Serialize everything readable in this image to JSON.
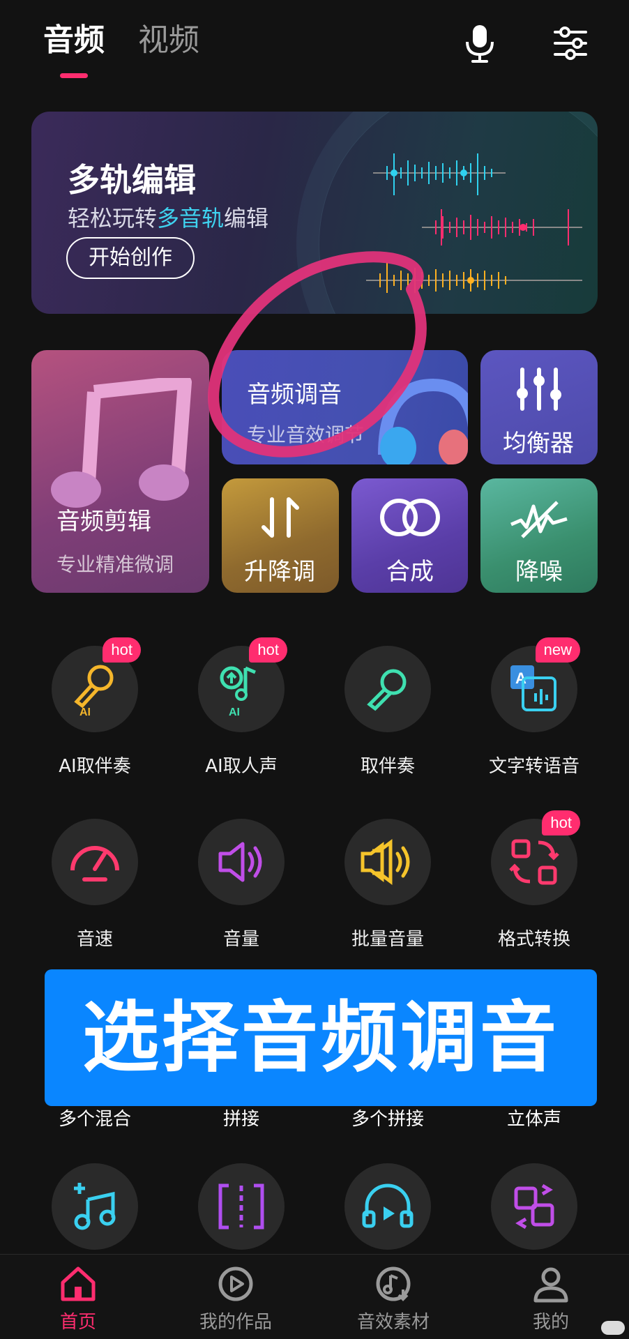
{
  "top_tabs": [
    {
      "label": "音频"
    },
    {
      "label": "视频"
    }
  ],
  "banner": {
    "title": "多轨编辑",
    "subtitle_pre": "轻松玩转",
    "subtitle_highlight": "多音轨",
    "subtitle_post": "编辑",
    "button": "开始创作"
  },
  "tiles": {
    "audio_edit": {
      "label": "音频剪辑",
      "sub": "专业精准微调"
    },
    "audio_tune": {
      "label": "音频调音",
      "sub": "专业音效调节"
    },
    "equalizer": {
      "label": "均衡器"
    },
    "pitch": {
      "label": "升降调"
    },
    "mix": {
      "label": "合成"
    },
    "denoise": {
      "label": "降噪"
    }
  },
  "grid": [
    {
      "label": "AI取伴奏",
      "badge": "hot",
      "icon": "ai-mic-icon",
      "sub": "AI"
    },
    {
      "label": "AI取人声",
      "badge": "hot",
      "icon": "ai-voice-icon",
      "sub": "AI"
    },
    {
      "label": "取伴奏",
      "badge": "",
      "icon": "mic-icon"
    },
    {
      "label": "文字转语音",
      "badge": "new",
      "icon": "text-to-speech-icon"
    },
    {
      "label": "音速",
      "badge": "",
      "icon": "speed-icon"
    },
    {
      "label": "音量",
      "badge": "",
      "icon": "volume-icon"
    },
    {
      "label": "批量音量",
      "badge": "",
      "icon": "batch-volume-icon"
    },
    {
      "label": "格式转换",
      "badge": "hot",
      "icon": "format-convert-icon"
    }
  ],
  "caption": "选择音频调音",
  "partial_labels": [
    "多个混合",
    "拼接",
    "多个拼接",
    "立体声"
  ],
  "bottom_nav": [
    {
      "label": "首页"
    },
    {
      "label": "我的作品"
    },
    {
      "label": "音效素材"
    },
    {
      "label": "我的"
    }
  ],
  "colors": {
    "accent": "#ff2d6f",
    "caption_bg": "#0a86ff"
  }
}
